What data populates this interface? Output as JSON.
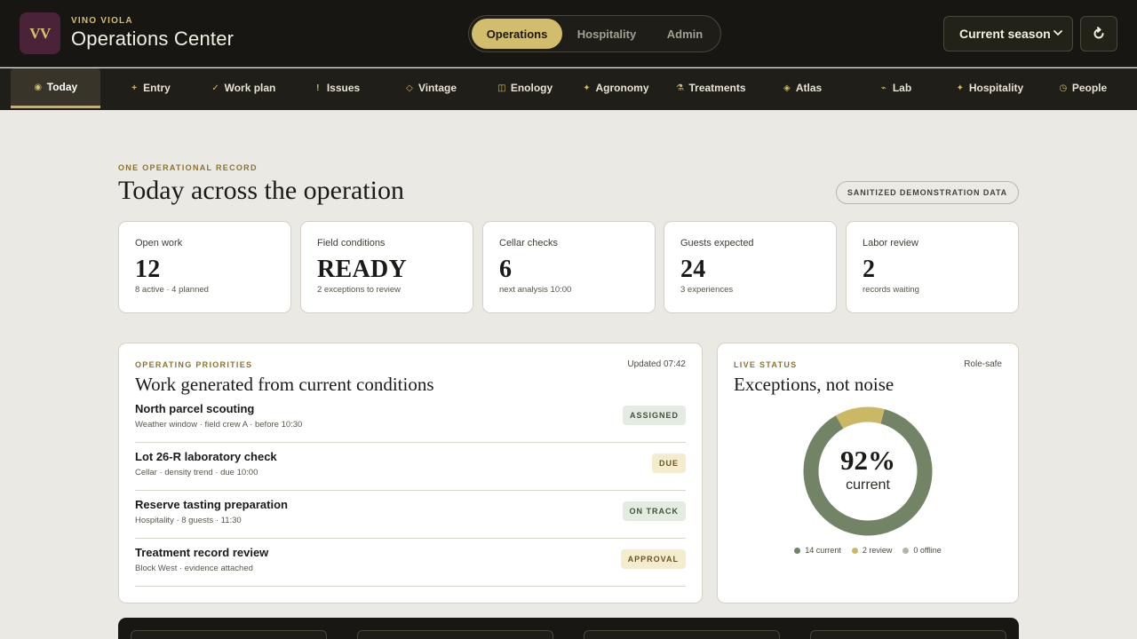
{
  "brand": {
    "logo": "VV",
    "kicker": "VINO VIOLA",
    "title": "Operations Center"
  },
  "mode_switch": [
    {
      "label": "Operations",
      "active": true
    },
    {
      "label": "Hospitality",
      "active": false
    },
    {
      "label": "Admin",
      "active": false
    }
  ],
  "season_select": {
    "value": "Current season"
  },
  "refresh": {
    "glyph": "↻"
  },
  "nav": [
    {
      "label": "Today",
      "glyph": "◉",
      "active": true
    },
    {
      "label": "Entry",
      "glyph": "+"
    },
    {
      "label": "Work plan",
      "glyph": "✓"
    },
    {
      "label": "Issues",
      "glyph": "!"
    },
    {
      "label": "Vintage",
      "glyph": "◇"
    },
    {
      "label": "Enology",
      "glyph": "◫"
    },
    {
      "label": "Agronomy",
      "glyph": "✦"
    },
    {
      "label": "Treatments",
      "glyph": "⚗"
    },
    {
      "label": "Atlas",
      "glyph": "◈"
    },
    {
      "label": "Lab",
      "glyph": "⌁"
    },
    {
      "label": "Hospitality",
      "glyph": "✦"
    },
    {
      "label": "People",
      "glyph": "◷"
    }
  ],
  "page": {
    "kicker": "ONE OPERATIONAL RECORD",
    "title": "Today across the operation",
    "demo_badge": "SANITIZED DEMONSTRATION DATA"
  },
  "stats": [
    {
      "label": "Open work",
      "value": "12",
      "sub": "8 active · 4 planned"
    },
    {
      "label": "Field conditions",
      "value": "READY",
      "sub": "2 exceptions to review"
    },
    {
      "label": "Cellar checks",
      "value": "6",
      "sub": "next analysis 10:00"
    },
    {
      "label": "Guests expected",
      "value": "24",
      "sub": "3 experiences"
    },
    {
      "label": "Labor review",
      "value": "2",
      "sub": "records waiting"
    }
  ],
  "priorities": {
    "kicker": "OPERATING PRIORITIES",
    "updated": "Updated 07:42",
    "title": "Work generated from current conditions",
    "items": [
      {
        "name": "North parcel scouting",
        "detail": "Weather window · field crew A · before 10:30",
        "status": "ASSIGNED",
        "tone": "green"
      },
      {
        "name": "Lot 26-R laboratory check",
        "detail": "Cellar · density trend · due 10:00",
        "status": "DUE",
        "tone": "yellow"
      },
      {
        "name": "Reserve tasting preparation",
        "detail": "Hospitality · 8 guests · 11:30",
        "status": "ON TRACK",
        "tone": "green"
      },
      {
        "name": "Treatment record review",
        "detail": "Block West · evidence attached",
        "status": "APPROVAL",
        "tone": "yellow"
      }
    ]
  },
  "live_status": {
    "kicker": "LIVE STATUS",
    "meta": "Role-safe",
    "title": "Exceptions, not noise",
    "percent": "92%",
    "percent_label": "current",
    "segments": [
      {
        "label": "14 current",
        "count": 14,
        "color": "#738466"
      },
      {
        "label": "2 review",
        "count": 2,
        "color": "#cbb865"
      },
      {
        "label": "0 offline",
        "count": 0,
        "color": "#b5b2aa"
      }
    ]
  }
}
